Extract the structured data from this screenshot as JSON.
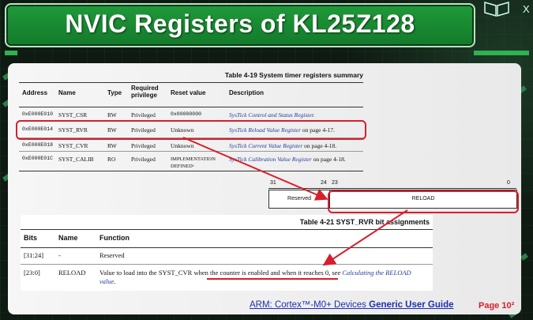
{
  "slide": {
    "title": "NVIC Registers of KL25Z128",
    "close_glyph": "X",
    "footer": {
      "link_prefix": "ARM: Cortex™-M0+ Devices ",
      "link_bold": "Generic User Guide",
      "page_label": "Page 10²"
    }
  },
  "table_4_19": {
    "caption": "Table 4-19 System timer registers summary",
    "headers": {
      "address": "Address",
      "name": "Name",
      "type": "Type",
      "required_privilege_line1": "Required",
      "required_privilege_line2": "privilege",
      "reset_value": "Reset value",
      "description": "Description"
    },
    "rows": [
      {
        "address": "0xE000E010",
        "name": "SYST_CSR",
        "type": "RW",
        "privilege": "Privileged",
        "reset": "0x00000000",
        "reset2": "",
        "desc_link": "SysTick Control and Status Register.",
        "desc_rest": ""
      },
      {
        "address": "0xE000E014",
        "name": "SYST_RVR",
        "type": "RW",
        "privilege": "Privileged",
        "reset": "Unknown",
        "reset2": "",
        "desc_link": "SysTick Reload Value Register",
        "desc_rest": " on page 4-17."
      },
      {
        "address": "0xE000E018",
        "name": "SYST_CVR",
        "type": "RW",
        "privilege": "Privileged",
        "reset": "Unknown",
        "reset2": "",
        "desc_link": "SysTick Current Value Register",
        "desc_rest": " on page 4-18."
      },
      {
        "address": "0xE000E01C",
        "name": "SYST_CALIB",
        "type": "RO",
        "privilege": "Privileged",
        "reset": "IMPLEMENTATION",
        "reset2": "DEFINEDᵃ",
        "desc_link": "SysTick Calibration Value Register",
        "desc_rest": " on page 4-18."
      }
    ]
  },
  "bitfield": {
    "bit_31": "31",
    "bit_24": "24",
    "bit_23": "23",
    "bit_0": "0",
    "field_reserved": "Reserved",
    "field_reload": "RELOAD"
  },
  "table_4_21": {
    "caption": "Table 4-21 SYST_RVR bit assignments",
    "headers": {
      "bits": "Bits",
      "name": "Name",
      "function": "Function"
    },
    "rows": [
      {
        "bits": "[31:24]",
        "name": "-",
        "function_text": "Reserved",
        "function_link": ""
      },
      {
        "bits": "[23:0]",
        "name": "RELOAD",
        "function_text": "Value to load into the SYST_CVR when the counter is enabled and when it reaches 0, see ",
        "function_link": "Calculating the RELOAD value",
        "function_end": "."
      }
    ]
  },
  "colors": {
    "title_green": "#1f9a3a",
    "highlight_red": "#d81e2a",
    "link_blue": "#1d2fb0"
  }
}
